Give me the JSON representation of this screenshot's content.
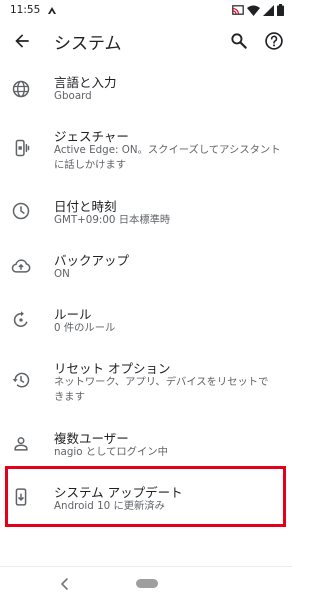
{
  "status": {
    "time": "11:55"
  },
  "appbar": {
    "title": "システム"
  },
  "items": [
    {
      "title": "言語と入力",
      "subtitle": "Gboard"
    },
    {
      "title": "ジェスチャー",
      "subtitle_line1": "Active Edge: ON。スクイーズしてアシスタント",
      "subtitle_line2": "に話しかけます"
    },
    {
      "title": "日付と時刻",
      "subtitle": "GMT+09:00 日本標準時"
    },
    {
      "title": "バックアップ",
      "subtitle": "ON"
    },
    {
      "title": "ルール",
      "subtitle": "0 件のルール"
    },
    {
      "title": "リセット オプション",
      "subtitle_line1": "ネットワーク、アプリ、デバイスをリセットで",
      "subtitle_line2": "きます"
    },
    {
      "title": "複数ユーザー",
      "subtitle": "nagio としてログイン中"
    },
    {
      "title": "システム アップデート",
      "subtitle": "Android 10 に更新済み"
    }
  ],
  "icons": {
    "items": [
      "globe-icon",
      "gesture-icon",
      "clock-icon",
      "cloud-upload-icon",
      "rules-icon",
      "restore-icon",
      "person-icon",
      "system-update-icon"
    ]
  },
  "colors": {
    "highlight": "#e5001a",
    "text_primary": "#202124",
    "text_secondary": "#5f6368",
    "icon": "#5f6368"
  }
}
